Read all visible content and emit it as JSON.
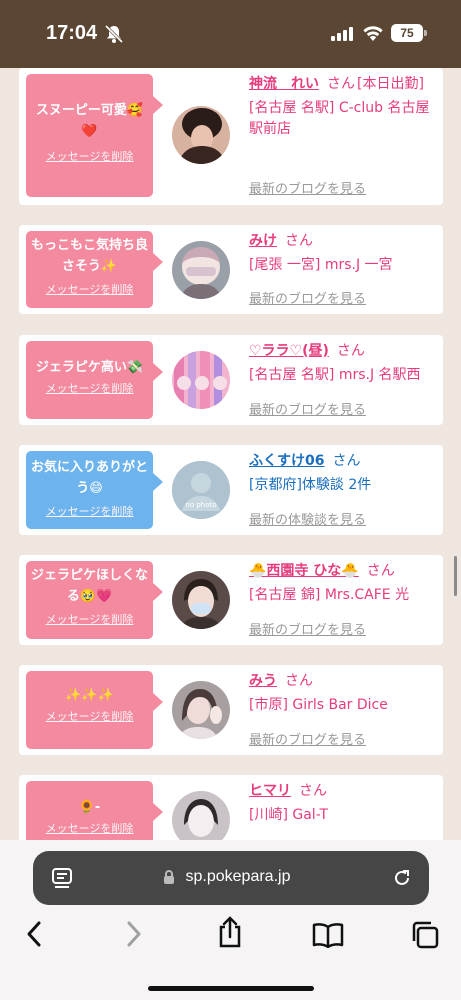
{
  "status": {
    "time": "17:04",
    "battery": "75"
  },
  "feed": [
    {
      "bubble": "スヌーピー可愛🥰❤️",
      "delete": "メッセージを削除",
      "name": "神流　れい",
      "honorific": "さん",
      "suffix": "[本日出勤]",
      "shop": "[名古屋 名駅] C-club 名古屋駅前店",
      "link": "最新のブログを見る"
    },
    {
      "bubble": "もっこもこ気持ち良さそう✨",
      "delete": "メッセージを削除",
      "name": "みけ",
      "honorific": "さん",
      "shop": "[尾張 一宮] mrs.J 一宮",
      "link": "最新のブログを見る"
    },
    {
      "bubble": "ジェラピケ高い💸",
      "delete": "メッセージを削除",
      "name": "♡ララ♡(昼)",
      "honorific": "さん",
      "shop": "[名古屋 名駅] mrs.J 名駅西",
      "link": "最新のブログを見る"
    },
    {
      "bubble": "お気に入りありがとう😄",
      "delete": "メッセージを削除",
      "name": "ふくすけ06",
      "honorific": "さん",
      "shop": "[京都府]体験談 2件",
      "link": "最新の体験談を見る",
      "avatar_text": "no photo"
    },
    {
      "bubble": "ジェラピケほしくなる🥹💗",
      "delete": "メッセージを削除",
      "name": "🐣西園寺 ひな🐣",
      "honorific": "さん",
      "shop": "[名古屋 錦] Mrs.CAFE 光",
      "link": "最新のブログを見る"
    },
    {
      "bubble": "✨✨✨",
      "delete": "メッセージを削除",
      "name": "みう",
      "honorific": "さん",
      "shop": "[市原] Girls Bar Dice",
      "link": "最新のブログを見る"
    },
    {
      "bubble": "🌻-",
      "delete": "メッセージを削除",
      "name": "ヒマリ",
      "honorific": "さん",
      "shop": "[川崎] Gal-T",
      "link": ""
    }
  ],
  "browser": {
    "url": "sp.pokepara.jp"
  },
  "colors": {
    "status_bar": "#5a4632",
    "accent_pink": "#e63c7e",
    "bubble_pink": "#f48aa0",
    "bubble_blue": "#6db3ee",
    "link_blue": "#1a6fc0"
  }
}
